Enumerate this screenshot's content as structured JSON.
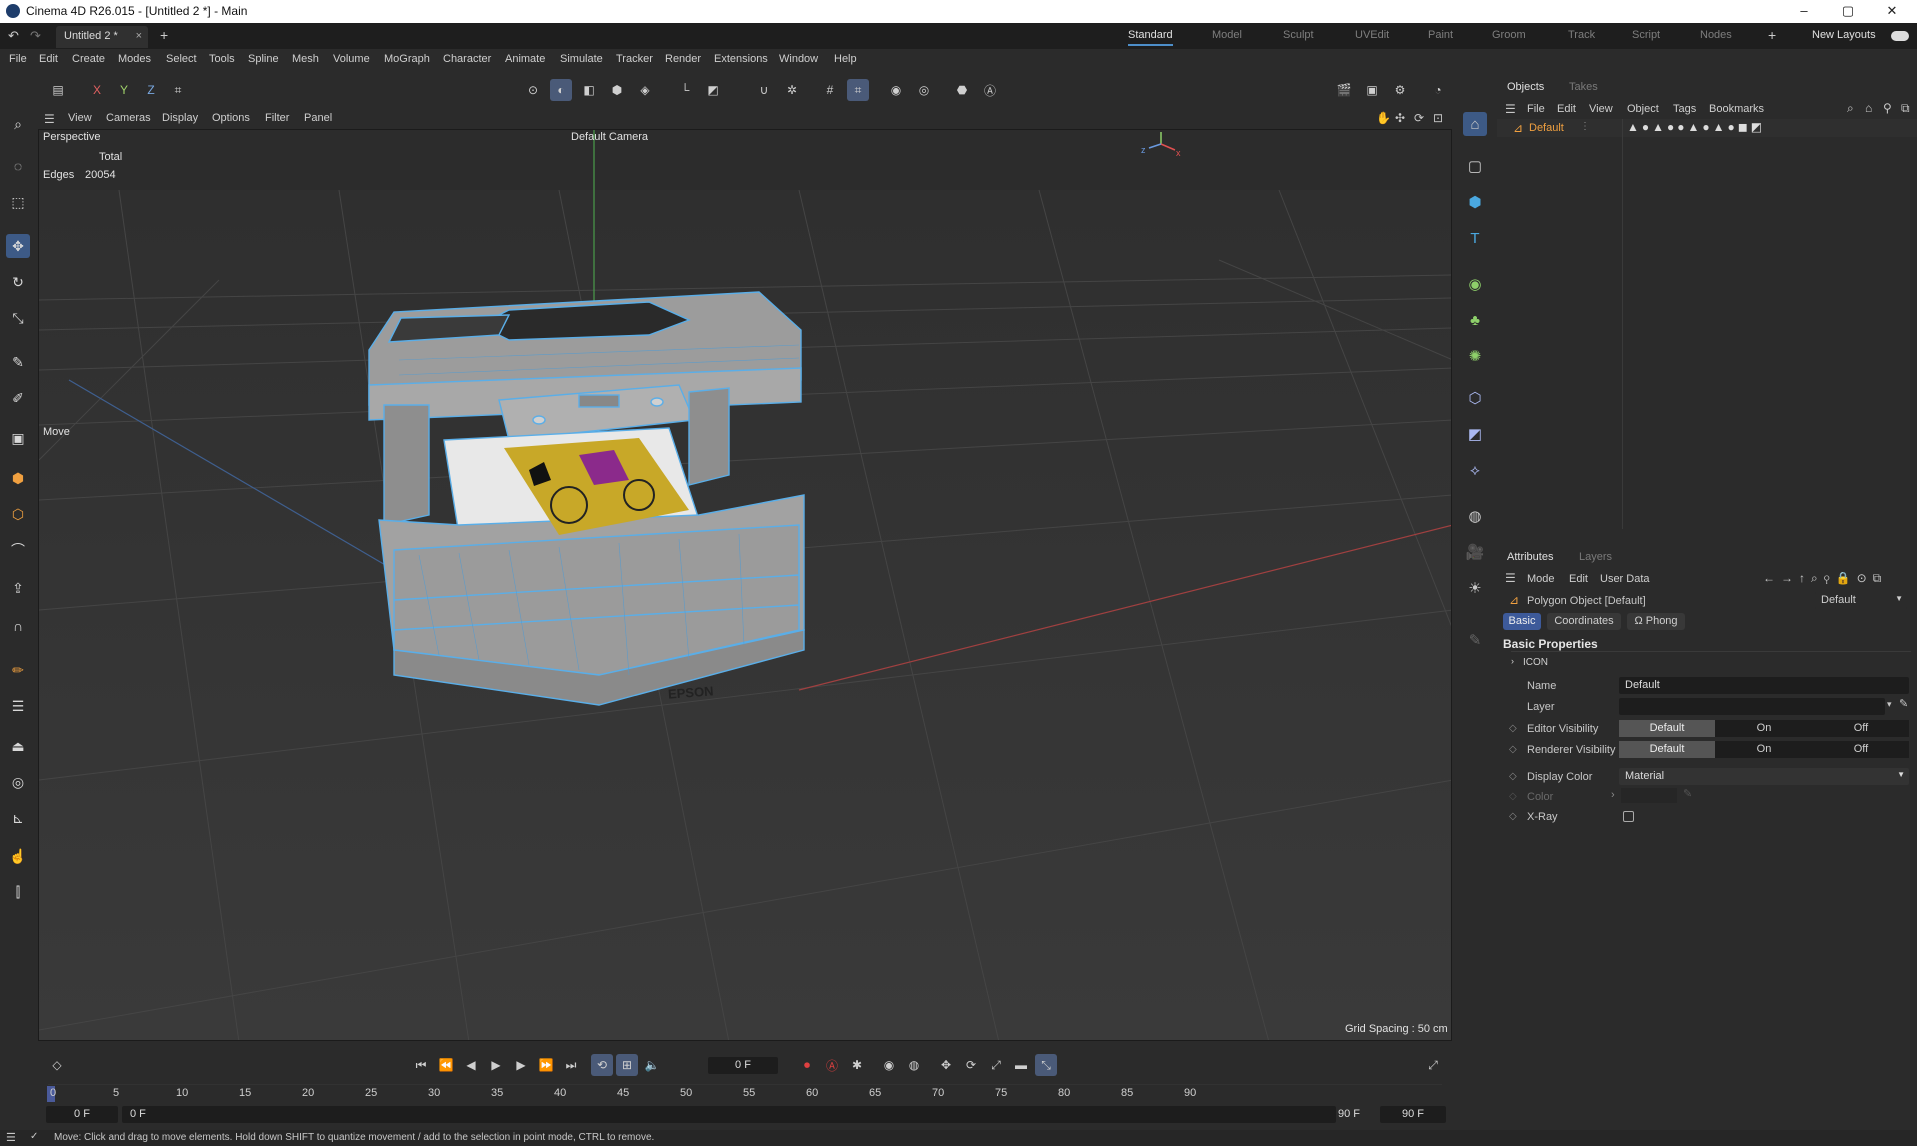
{
  "window": {
    "title": "Cinema 4D R26.015 - [Untitled 2 *] - Main",
    "minimize": "–",
    "maximize": "▢",
    "close": "✕"
  },
  "tabs": {
    "doc_tab": "Untitled 2 *",
    "doc_close": "×",
    "new_tab": "+"
  },
  "layouts": [
    "Standard",
    "Model",
    "Sculpt",
    "UVEdit",
    "Paint",
    "Groom",
    "Track",
    "Script",
    "Nodes"
  ],
  "new_layouts": "New Layouts",
  "menu": [
    "File",
    "Edit",
    "Create",
    "Modes",
    "Select",
    "Tools",
    "Spline",
    "Mesh",
    "Volume",
    "MoGraph",
    "Character",
    "Animate",
    "Simulate",
    "Tracker",
    "Render",
    "Extensions",
    "Window",
    "Help"
  ],
  "axis_toggles": {
    "x": "X",
    "y": "Y",
    "z": "Z"
  },
  "viewport_menu": [
    "View",
    "Cameras",
    "Display",
    "Options",
    "Filter",
    "Panel"
  ],
  "viewport": {
    "name": "Perspective",
    "camera": "Default Camera",
    "stats_header": "Total",
    "stats_label": "Edges",
    "stats_value": "20054",
    "tool_label": "Move",
    "grid_spacing": "Grid Spacing : 50 cm",
    "brand": "EPSON"
  },
  "timeline": {
    "current_frame": "0 F",
    "ticks": [
      "0",
      "5",
      "10",
      "15",
      "20",
      "25",
      "30",
      "35",
      "40",
      "45",
      "50",
      "55",
      "60",
      "65",
      "70",
      "75",
      "80",
      "85",
      "90"
    ],
    "start_field": "0 F",
    "start_field2": "0 F",
    "end_field": "90 F",
    "end_field2": "90 F"
  },
  "status_text": "Move: Click and drag to move elements. Hold down SHIFT to quantize movement / add to the selection in point mode, CTRL to remove.",
  "objects_panel": {
    "tabs": [
      "Objects",
      "Takes"
    ],
    "menu": [
      "File",
      "Edit",
      "View",
      "Object",
      "Tags",
      "Bookmarks"
    ],
    "object_name": "Default"
  },
  "attributes_panel": {
    "tabs": [
      "Attributes",
      "Layers"
    ],
    "menu": [
      "Mode",
      "Edit",
      "User Data"
    ],
    "object_label": "Polygon Object [Default]",
    "preset": "Default",
    "sub_tabs": [
      "Basic",
      "Coordinates",
      "Phong"
    ],
    "section": "Basic Properties",
    "icon_group": "ICON",
    "name_label": "Name",
    "name_value": "Default",
    "layer_label": "Layer",
    "layer_value": "",
    "editor_vis_label": "Editor Visibility",
    "renderer_vis_label": "Renderer Visibility",
    "vis_options": [
      "Default",
      "On",
      "Off"
    ],
    "display_color_label": "Display Color",
    "display_color_value": "Material",
    "color_label": "Color",
    "xray_label": "X-Ray"
  },
  "colors": {
    "accent": "#4d8ec9",
    "wire": "#5aaee8",
    "body": "#9a9a9a",
    "selection_blue": "#3d5a86"
  }
}
